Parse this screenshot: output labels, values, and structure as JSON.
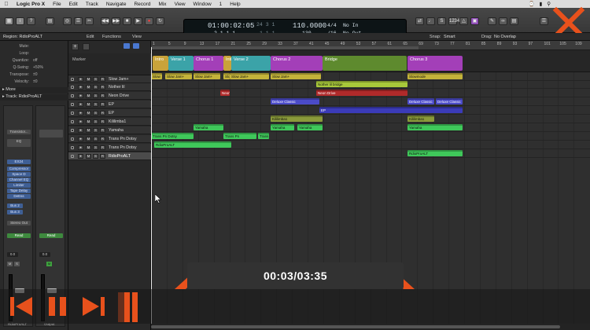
{
  "menubar": {
    "items": [
      "Logic Pro X",
      "File",
      "Edit",
      "Track",
      "Navigate",
      "Record",
      "Mix",
      "View",
      "Window",
      "1",
      "Help"
    ],
    "window_title": "Song 1-Audio Tut-Record&Edit - Julian Go - Tracks"
  },
  "transport": {
    "time": "01:00:02:05",
    "bars": "2 1 1 1",
    "bars_small": "24 3 1",
    "bars_small2": "1 1 1",
    "tempo": "110.0000",
    "tempo_small": "130",
    "signature": "4/4",
    "division": "/16",
    "in_label": "No In",
    "out_label": "No Out"
  },
  "subbar": {
    "region_label": "Region: RdioProALT",
    "edit": "Edit",
    "functions": "Functions",
    "view": "View",
    "snap_label": "Snap:",
    "snap_value": "Smart",
    "drag_label": "Drag:",
    "drag_value": "No Overlap"
  },
  "inspector": {
    "params": [
      {
        "k": "Mute:",
        "v": ""
      },
      {
        "k": "Loop:",
        "v": ""
      },
      {
        "k": "Quantize:",
        "v": "off"
      },
      {
        "k": "Q-Swing:",
        "v": "+50%"
      },
      {
        "k": "Transpose:",
        "v": "±0"
      },
      {
        "k": "Velocity:",
        "v": "±0"
      }
    ],
    "more": "More",
    "track_label": "Track: RdioProALT",
    "plugins": [
      "Transistor...",
      "EQ",
      "",
      "EX24",
      "Compressor",
      "Space D",
      "Channel EQ",
      "Limiter",
      "Tape Delay",
      "DeEss"
    ],
    "sends": [
      "Bus 2",
      "Bus 3"
    ],
    "stereo_out": "Stereo Out",
    "read1": "Read",
    "read2": "Read",
    "vol1": "0.0",
    "vol2": "0.0",
    "strip1_name": "RdioProALT",
    "strip2_name": "Output"
  },
  "tracks": {
    "marker": "Marker",
    "rows": [
      {
        "name": "Slow Jam+"
      },
      {
        "name": "Nother lil"
      },
      {
        "name": "Neon Drive"
      },
      {
        "name": "EP"
      },
      {
        "name": "EP"
      },
      {
        "name": "Kililimba1"
      },
      {
        "name": "Yamaha"
      },
      {
        "name": "Trans Pn Dotsy"
      },
      {
        "name": "Trans Pn Dotsy"
      },
      {
        "name": "RdioProALT"
      }
    ]
  },
  "ruler_ticks": [
    "1",
    "5",
    "9",
    "13",
    "17",
    "21",
    "25",
    "29",
    "33",
    "37",
    "41",
    "45",
    "49",
    "53",
    "57",
    "61",
    "65",
    "69",
    "73",
    "77",
    "81",
    "85",
    "89",
    "93",
    "97",
    "101",
    "105",
    "109"
  ],
  "markers": [
    {
      "label": "Intro",
      "color": "#c9a33a"
    },
    {
      "label": "Verse 1",
      "color": "#3ba3a8"
    },
    {
      "label": "Chorus 1",
      "color": "#a33fb8"
    },
    {
      "label": "Intr",
      "color": "#c9a33a"
    },
    {
      "label": "Verse 2",
      "color": "#3ba3a8"
    },
    {
      "label": "Chorus 2",
      "color": "#a33fb8"
    },
    {
      "label": "Bridge",
      "color": "#5e8a2e"
    },
    {
      "label": "Chorus 3",
      "color": "#a33fb8"
    }
  ],
  "regions": [
    {
      "label": "Slow",
      "color": "#c3b33a"
    },
    {
      "label": "Slow Jam+",
      "color": "#c3b33a"
    },
    {
      "label": "Slow Jam+",
      "color": "#c3b33a"
    },
    {
      "label": "Slow Jam+",
      "color": "#c3b33a"
    },
    {
      "label": "Slow Jam+",
      "color": "#c3b33a"
    },
    {
      "label": "Slow Jam+",
      "color": "#c3b33a"
    },
    {
      "label": "Slowmode",
      "color": "#c3b33a"
    },
    {
      "label": "Nother lil bridge",
      "color": "#a8c83a"
    },
    {
      "label": "Neon",
      "color": "#b02a2a"
    },
    {
      "label": "Neon Drive",
      "color": "#b02a2a"
    },
    {
      "label": "Deluxe Classic",
      "color": "#4b4bc8"
    },
    {
      "label": "Deluxe Classic",
      "color": "#4b4bc8"
    },
    {
      "label": "Deluxe Classic",
      "color": "#4b4bc8"
    },
    {
      "label": "EP",
      "color": "#3b3bb8"
    },
    {
      "label": "Kililimba1",
      "color": "#8a9a3a"
    },
    {
      "label": "Kililimba1",
      "color": "#8a9a3a"
    },
    {
      "label": "Yamaha",
      "color": "#3fc85a"
    },
    {
      "label": "Yamaha",
      "color": "#3fc85a"
    },
    {
      "label": "Yamaha",
      "color": "#3fc85a"
    },
    {
      "label": "Yamaha",
      "color": "#3fc85a"
    },
    {
      "label": "Trans Pn Dotsy",
      "color": "#3fc85a"
    },
    {
      "label": "Trans Pn",
      "color": "#3fc85a"
    },
    {
      "label": "Trans",
      "color": "#3fc85a"
    },
    {
      "label": "RdioProALT",
      "color": "#3fc85a"
    },
    {
      "label": "RdioProALT",
      "color": "#3fc85a"
    }
  ],
  "player": {
    "time": "00:03/03:35",
    "progress": 0.014,
    "accent": "#e8511c"
  }
}
